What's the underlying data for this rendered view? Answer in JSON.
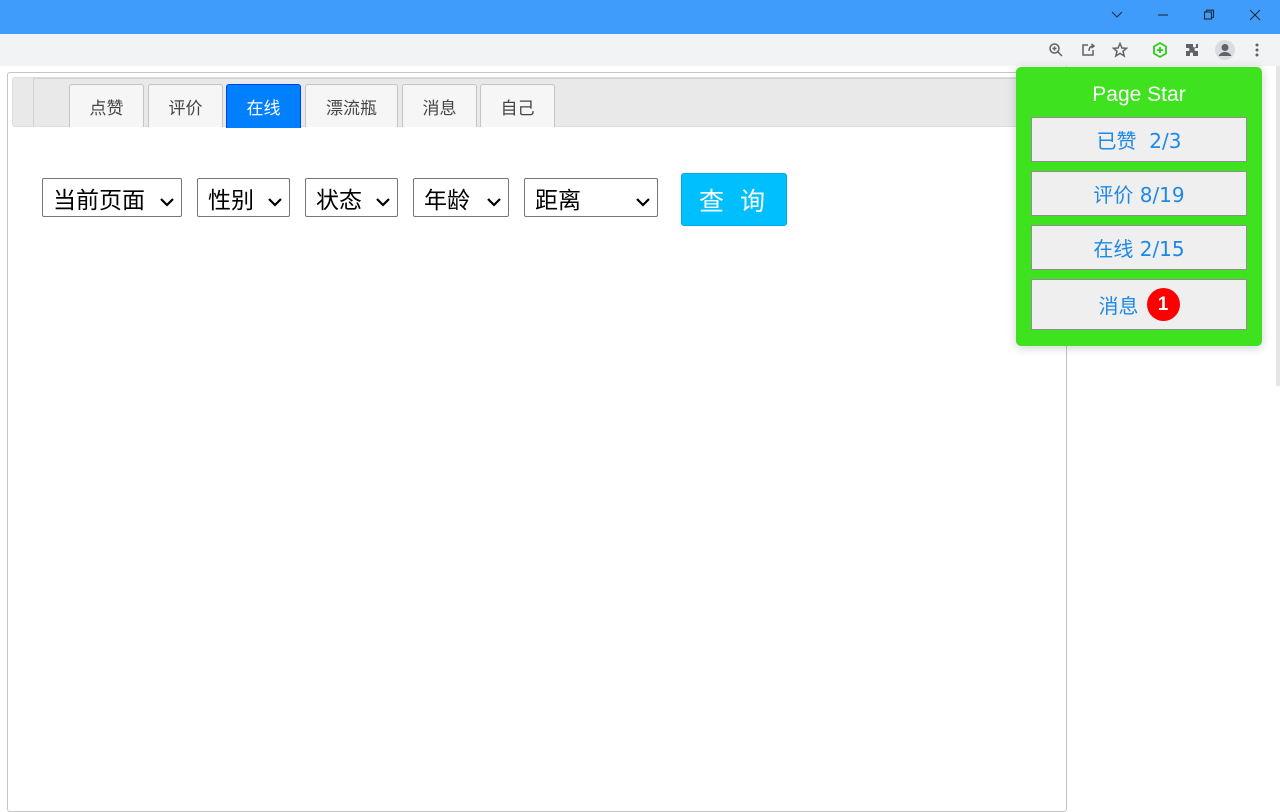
{
  "browser": {
    "window_controls": {
      "tab_search_icon": "chevron-down",
      "minimize_icon": "minimize",
      "restore_icon": "restore",
      "close_icon": "close"
    },
    "toolbar_icons": [
      "zoom-icon",
      "share-icon",
      "star-icon",
      "extension-puzzle-green-icon",
      "extensions-icon",
      "profile-icon",
      "more-menu-icon"
    ]
  },
  "dialog": {
    "tabs": [
      {
        "label": "点赞",
        "active": false
      },
      {
        "label": "评价",
        "active": false
      },
      {
        "label": "在线",
        "active": true
      },
      {
        "label": "漂流瓶",
        "active": false
      },
      {
        "label": "消息",
        "active": false
      },
      {
        "label": "自己",
        "active": false
      }
    ],
    "close_icon": "close-x"
  },
  "filters": {
    "page_select": "当前页面",
    "gender_select": "性别",
    "status_select": "状态",
    "age_select": "年龄",
    "distance_select": "距离",
    "query_button": "查 询"
  },
  "page_star": {
    "title": "Page Star",
    "liked": "已赞  2/3",
    "reviews": "评价 8/19",
    "online": "在线 2/15",
    "messages": "消息",
    "messages_badge": "1"
  },
  "colors": {
    "titlebar": "#3f9cfb",
    "active_tab": "#007fff",
    "query_button": "#00bfff",
    "page_star_bg": "#3ee21f",
    "link_blue": "#1e88e5",
    "badge_red": "#ff0000"
  }
}
